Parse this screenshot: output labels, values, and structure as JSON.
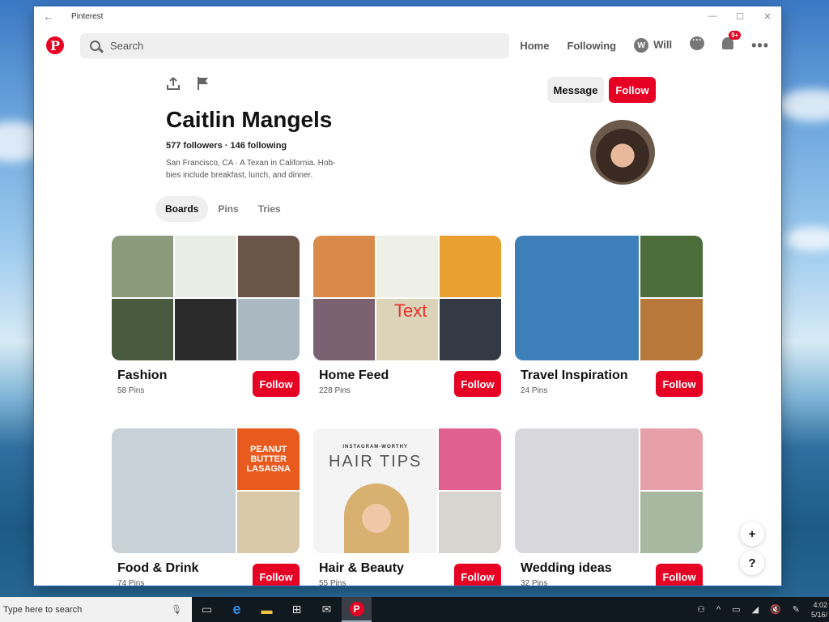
{
  "window": {
    "title": "Pinterest",
    "back_icon": "←",
    "controls": [
      "—",
      "☐",
      "✕"
    ]
  },
  "nav": {
    "logo": "P",
    "search_placeholder": "Search",
    "links": [
      "Home",
      "Following"
    ],
    "user_initial": "W",
    "user_name": "Will",
    "notification_badge": "9+",
    "more": "•••"
  },
  "profile": {
    "name": "Caitlin Mangels",
    "stats": "577 followers · 146 following",
    "bio": "San Francisco, CA  ·  A Texan in California. Hob-bies include breakfast, lunch, and dinner.",
    "message_label": "Message",
    "follow_label": "Follow",
    "tabs": [
      "Boards",
      "Pins",
      "Tries"
    ],
    "active_tab": "Boards"
  },
  "boards": [
    {
      "name": "Fashion",
      "pins": "58 Pins",
      "follow": "Follow",
      "colors": [
        "#8a9a7a",
        "#e8eee6",
        "#6b5448",
        "#4a5a3e",
        "#2b2b2b",
        "#aab8c2"
      ]
    },
    {
      "name": "Home Feed",
      "pins": "228 Pins",
      "follow": "Follow",
      "colors": [
        "#d98a4a",
        "#eef0e8",
        "#e9a030",
        "#7a6070",
        "#dcd4b8",
        "#333a44"
      ],
      "overlay_text": "Text"
    },
    {
      "name": "Travel Inspiration",
      "pins": "24 Pins",
      "follow": "Follow",
      "colors": [
        "#3d7fb8",
        "#4b6e3a",
        "#b8783a"
      ]
    },
    {
      "name": "Food & Drink",
      "pins": "74 Pins",
      "follow": "Follow",
      "colors": [
        "#c8d0d8",
        "#e85a1e",
        "#d8c8a8"
      ],
      "image_text": "PEANUT BUTTER LASAGNA"
    },
    {
      "name": "Hair & Beauty",
      "pins": "55 Pins",
      "follow": "Follow",
      "colors": [
        "#f4f4f4",
        "#e06090",
        "#d8d4d0"
      ],
      "image_kicker": "INSTAGRAM-WORTHY",
      "image_title": "HAIR TIPS"
    },
    {
      "name": "Wedding ideas",
      "pins": "32 Pins",
      "follow": "Follow",
      "colors": [
        "#d8d8dc",
        "#e8a0a8",
        "#a8b8a0"
      ]
    }
  ],
  "fabs": [
    "+",
    "?"
  ],
  "taskbar": {
    "search_placeholder": "Type here to search",
    "time": "4:02",
    "date": "5/16/"
  },
  "accent": "#e60023"
}
